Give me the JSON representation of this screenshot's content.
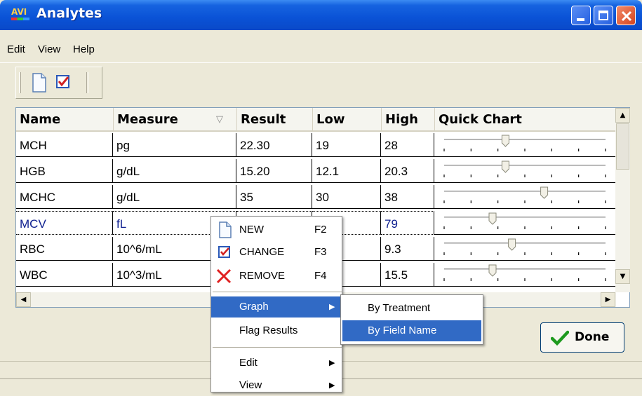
{
  "window": {
    "icon_text": "AVI",
    "title": "Analytes"
  },
  "menubar": {
    "items": [
      "Edit",
      "View",
      "Help"
    ]
  },
  "toolbar": {
    "icons": [
      "new-document-icon",
      "change-checkbox-icon"
    ]
  },
  "grid": {
    "columns": [
      "Name",
      "Measure",
      "Result",
      "Low",
      "High",
      "Quick Chart"
    ],
    "sort_indicator": "▽",
    "rows": [
      {
        "name": "MCH",
        "measure": "pg",
        "result": "22.30",
        "low": "19",
        "high": "28",
        "chart_level": 0.38
      },
      {
        "name": "HGB",
        "measure": "g/dL",
        "result": "15.20",
        "low": "12.1",
        "high": "20.3",
        "chart_level": 0.38
      },
      {
        "name": "MCHC",
        "measure": "g/dL",
        "result": "35",
        "low": "30",
        "high": "38",
        "chart_level": 0.62
      },
      {
        "name": "MCV",
        "measure": "fL",
        "result": "",
        "low": "",
        "high": "79",
        "chart_level": 0.3,
        "selected": true
      },
      {
        "name": "RBC",
        "measure": "10^6/mL",
        "result": "",
        "low": "",
        "high": "9.3",
        "chart_level": 0.42
      },
      {
        "name": "WBC",
        "measure": "10^3/mL",
        "result": "",
        "low": "",
        "high": "15.5",
        "chart_level": 0.3
      }
    ]
  },
  "context_menu": {
    "items": [
      {
        "label": "NEW",
        "key": "F2",
        "icon": "new-document-icon"
      },
      {
        "label": "CHANGE",
        "key": "F3",
        "icon": "change-checkbox-icon"
      },
      {
        "label": "REMOVE",
        "key": "F4",
        "icon": "remove-x-icon"
      },
      {
        "label": "Graph",
        "submenu": true,
        "highlighted": true
      },
      {
        "label": "Flag Results"
      },
      {
        "label": "Edit",
        "submenu": true
      },
      {
        "label": "View",
        "submenu": true
      }
    ]
  },
  "submenu": {
    "items": [
      "By Treatment",
      "By Field Name"
    ],
    "highlighted": "By Field Name"
  },
  "done_button": {
    "label": "Done",
    "icon": "checkmark-icon"
  },
  "colors": {
    "titlebar": "#0a52d6",
    "highlight": "#316ac5",
    "selected_text": "#0f2090"
  }
}
